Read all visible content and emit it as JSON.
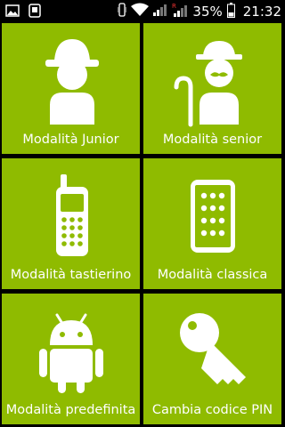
{
  "status_bar": {
    "icons": [
      "image-notification-icon",
      "android-notification-icon",
      "vibrate-icon",
      "wifi-icon",
      "signal-icon",
      "roaming-signal-icon",
      "battery-icon"
    ],
    "battery_text": "35%",
    "time": "21:32"
  },
  "colors": {
    "tile": "#8fbb00",
    "background": "#000000",
    "text": "#ffffff"
  },
  "tiles": [
    {
      "label": "Modalità Junior",
      "icon": "junior-icon"
    },
    {
      "label": "Modalità senior",
      "icon": "senior-icon"
    },
    {
      "label": "Modalità tastierino",
      "icon": "keypad-phone-icon"
    },
    {
      "label": "Modalità classica",
      "icon": "smartphone-icon"
    },
    {
      "label": "Modalità predefinita",
      "icon": "android-icon"
    },
    {
      "label": "Cambia codice PIN",
      "icon": "key-icon"
    }
  ]
}
